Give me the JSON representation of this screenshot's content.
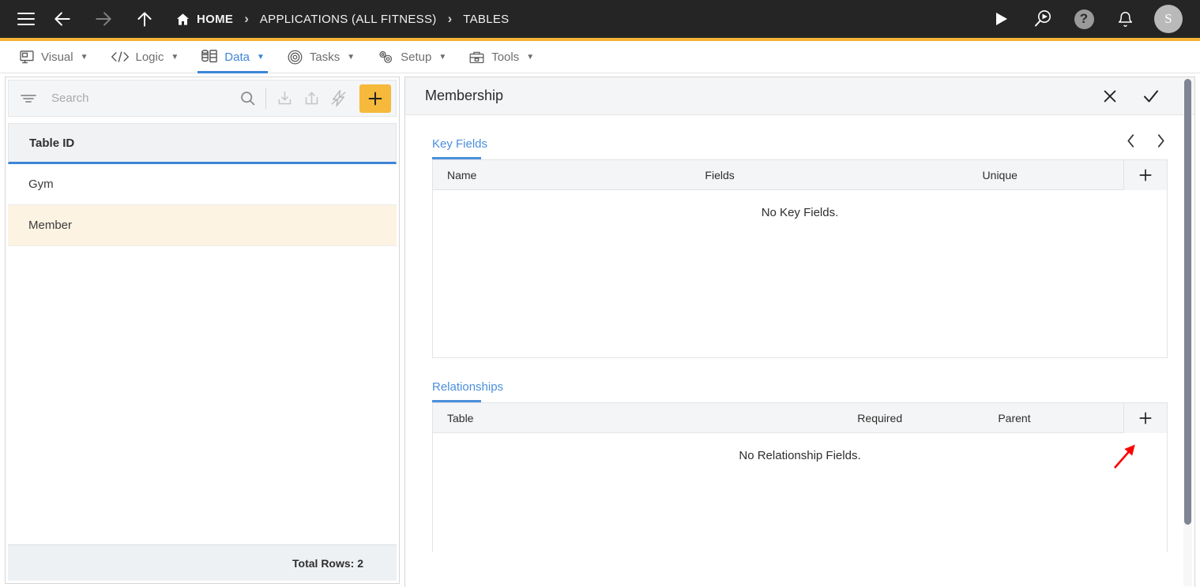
{
  "topbar": {
    "menu_icon": "hamburger-icon",
    "back_icon": "arrow-left-icon",
    "forward_icon": "arrow-right-icon",
    "up_icon": "arrow-up-icon",
    "breadcrumbs": [
      {
        "label": "HOME",
        "icon": "home-icon"
      },
      {
        "label": "APPLICATIONS (ALL FITNESS)",
        "icon": ""
      },
      {
        "label": "TABLES",
        "icon": ""
      }
    ],
    "separator": "›",
    "actions": [
      {
        "name": "run-icon",
        "glyph": "▶"
      },
      {
        "name": "debug-run-icon",
        "glyph": ""
      },
      {
        "name": "help-icon",
        "glyph": "?"
      },
      {
        "name": "notifications-bell-icon",
        "glyph": ""
      }
    ],
    "avatar_initial": "S",
    "accent_color": "#f5b335",
    "bg_color": "#252525"
  },
  "menubar": {
    "items": [
      {
        "label": "Visual",
        "icon": "monitor-icon",
        "active": false
      },
      {
        "label": "Logic",
        "icon": "code-icon",
        "active": false
      },
      {
        "label": "Data",
        "icon": "database-icon",
        "active": true
      },
      {
        "label": "Tasks",
        "icon": "target-gear-icon",
        "active": false
      },
      {
        "label": "Setup",
        "icon": "gears-icon",
        "active": false
      },
      {
        "label": "Tools",
        "icon": "toolbox-icon",
        "active": false
      }
    ],
    "caret": "▼",
    "active_color": "#3d85d8"
  },
  "left_panel": {
    "toolbar": {
      "filter_icon": "filter-icon",
      "search_placeholder": "Search",
      "search_value": "",
      "search_icon": "magnifier-icon",
      "import_icon": "import-download-icon",
      "export_icon": "export-share-icon",
      "flash_icon": "lightning-bolt-icon",
      "add_icon": "plus-icon",
      "add_button_color": "#f6b93b"
    },
    "column_header": "Table ID",
    "rows": [
      {
        "label": "Gym",
        "selected": false
      },
      {
        "label": "Member",
        "selected": true
      }
    ],
    "footer": "Total Rows: 2",
    "selected_row_color": "#fdf3e2",
    "header_underline_color": "#3d85d8"
  },
  "right_panel": {
    "title": "Membership",
    "close_icon": "close-x-icon",
    "confirm_icon": "checkmark-icon",
    "sections": [
      {
        "tab_label": "Key Fields",
        "prev_icon": "chevron-left-icon",
        "next_icon": "chevron-right-icon",
        "columns": [
          "Name",
          "Fields",
          "Unique"
        ],
        "add_icon": "plus-icon",
        "empty_message": "No Key Fields.",
        "rows": []
      },
      {
        "tab_label": "Relationships",
        "columns": [
          "Table",
          "Required",
          "Parent"
        ],
        "add_icon": "plus-icon",
        "empty_message": "No Relationship Fields.",
        "rows": []
      }
    ],
    "tab_color": "#4a8fdd"
  },
  "annotation": {
    "type": "arrow",
    "color": "#ff0000",
    "points_to": "relationships-add-button"
  }
}
